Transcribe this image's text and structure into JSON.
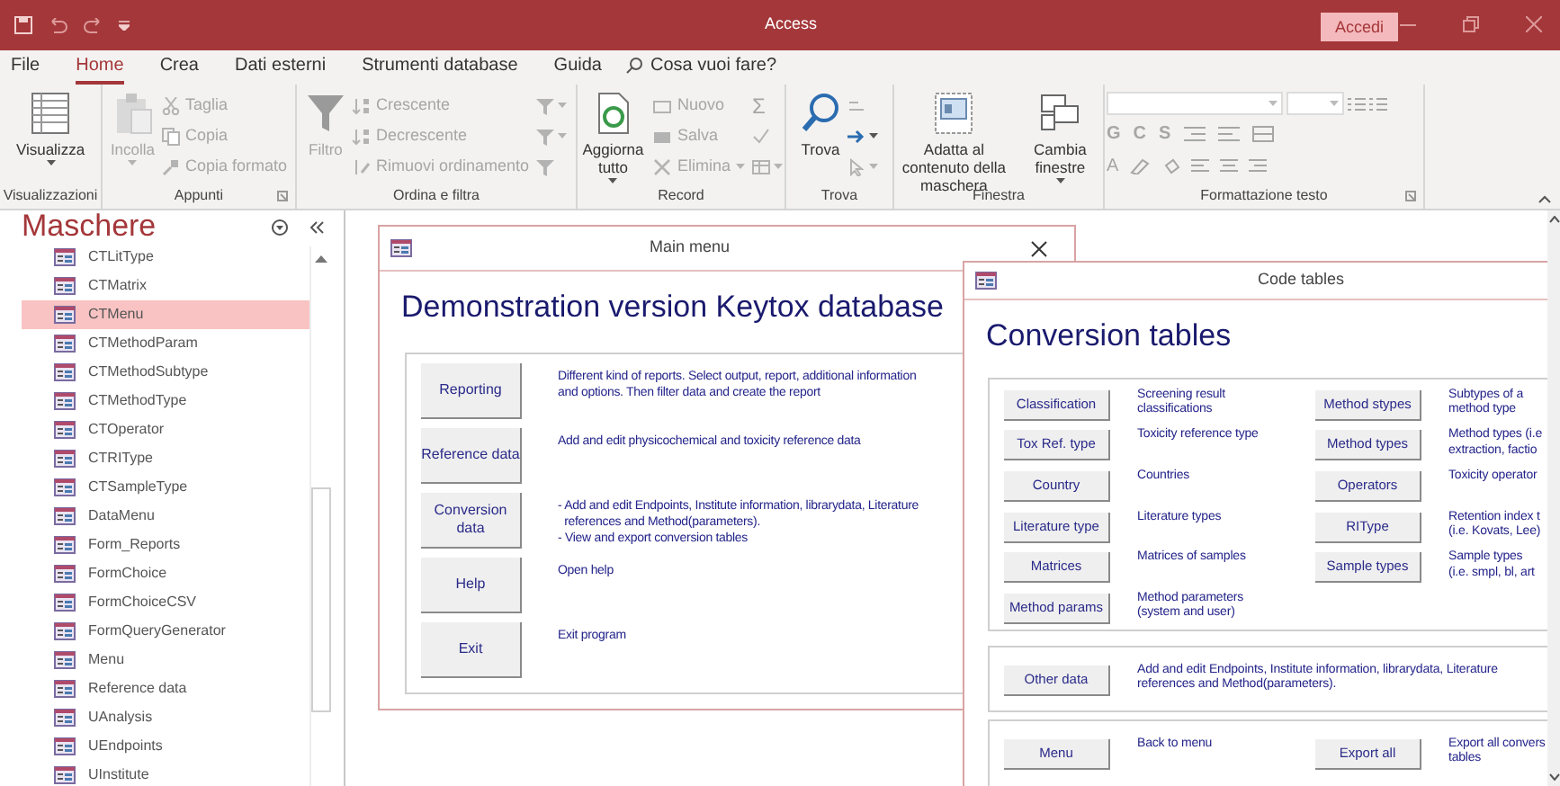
{
  "title_bar": {
    "title": "Access",
    "sign_in": "Accedi"
  },
  "ribbon_tabs": [
    {
      "label": "File",
      "selected": false
    },
    {
      "label": "Home",
      "selected": true
    },
    {
      "label": "Crea",
      "selected": false
    },
    {
      "label": "Dati esterni",
      "selected": false
    },
    {
      "label": "Strumenti database",
      "selected": false
    },
    {
      "label": "Guida",
      "selected": false
    }
  ],
  "tell_me": {
    "placeholder": "Cosa vuoi fare?"
  },
  "ribbon_groups": [
    {
      "label": "Visualizzazioni",
      "kind": "buttons",
      "columns": [
        [
          {
            "kind": "large",
            "label": "Visualizza",
            "dropdown": true,
            "disabled": false
          }
        ]
      ]
    },
    {
      "label": "Appunti",
      "kind": "buttons",
      "launcher": true,
      "columns": [
        [
          {
            "kind": "large",
            "label": "Incolla",
            "dropdown": true,
            "disabled": true
          }
        ],
        [
          {
            "kind": "small",
            "label": "Taglia",
            "disabled": true
          },
          {
            "kind": "small",
            "label": "Copia",
            "disabled": true
          },
          {
            "kind": "small",
            "label": "Copia formato",
            "disabled": true
          }
        ]
      ]
    },
    {
      "label": "Ordina e filtra",
      "kind": "buttons",
      "columns": [
        [
          {
            "kind": "large",
            "label": "Filtro",
            "disabled": true
          }
        ],
        [
          {
            "kind": "small",
            "label": "Crescente",
            "disabled": true
          },
          {
            "kind": "small",
            "label": "Decrescente",
            "disabled": true
          },
          {
            "kind": "small",
            "label": "Rimuovi ordinamento",
            "disabled": true
          }
        ],
        [
          {
            "kind": "icon",
            "dropdown": true,
            "disabled": true
          },
          {
            "kind": "icon",
            "dropdown": true,
            "disabled": true
          },
          {
            "kind": "icon",
            "disabled": true
          }
        ]
      ]
    },
    {
      "label": "Record",
      "kind": "buttons",
      "columns": [
        [
          {
            "kind": "large",
            "label": "Aggiorna tutto",
            "dropdown": true,
            "disabled": false
          }
        ],
        [
          {
            "kind": "small",
            "label": "Nuovo",
            "disabled": true
          },
          {
            "kind": "small",
            "label": "Salva",
            "disabled": true
          },
          {
            "kind": "small",
            "label": "Elimina",
            "dropdown": true,
            "disabled": true
          }
        ],
        [
          {
            "kind": "glyph",
            "label": "Σ",
            "disabled": true
          },
          {
            "kind": "icon",
            "disabled": true
          },
          {
            "kind": "icon",
            "dropdown": true,
            "disabled": true
          }
        ]
      ]
    },
    {
      "label": "Trova",
      "kind": "buttons",
      "columns": [
        [
          {
            "kind": "large",
            "label": "Trova",
            "disabled": false
          }
        ],
        [
          {
            "kind": "icon",
            "disabled": true
          },
          {
            "kind": "icon",
            "dropdown": true,
            "disabled": false
          },
          {
            "kind": "icon",
            "dropdown": true,
            "disabled": true
          }
        ]
      ]
    },
    {
      "label": "Finestra",
      "kind": "buttons",
      "columns": [
        [
          {
            "kind": "large",
            "label": "Adatta al contenuto della maschera",
            "disabled": false
          }
        ],
        [
          {
            "kind": "large",
            "label": "Cambia finestre",
            "dropdown": true,
            "disabled": false
          }
        ]
      ]
    },
    {
      "label": "Formattazione testo",
      "kind": "format",
      "launcher": true,
      "letters": [
        "G",
        "C",
        "S"
      ],
      "color_letter": "A"
    }
  ],
  "navigation": {
    "title": "Maschere",
    "items": [
      {
        "label": "CTLitType",
        "selected": false
      },
      {
        "label": "CTMatrix",
        "selected": false
      },
      {
        "label": "CTMenu",
        "selected": true
      },
      {
        "label": "CTMethodParam",
        "selected": false
      },
      {
        "label": "CTMethodSubtype",
        "selected": false
      },
      {
        "label": "CTMethodType",
        "selected": false
      },
      {
        "label": "CTOperator",
        "selected": false
      },
      {
        "label": "CTRIType",
        "selected": false
      },
      {
        "label": "CTSampleType",
        "selected": false
      },
      {
        "label": "DataMenu",
        "selected": false
      },
      {
        "label": "Form_Reports",
        "selected": false
      },
      {
        "label": "FormChoice",
        "selected": false
      },
      {
        "label": "FormChoiceCSV",
        "selected": false
      },
      {
        "label": "FormQueryGenerator",
        "selected": false
      },
      {
        "label": "Menu",
        "selected": false
      },
      {
        "label": "Reference data",
        "selected": false
      },
      {
        "label": "UAnalysis",
        "selected": false
      },
      {
        "label": "UEndpoints",
        "selected": false
      },
      {
        "label": "UInstitute",
        "selected": false
      }
    ]
  },
  "main_menu": {
    "title": "Main menu",
    "heading": "Demonstration version Keytox database",
    "rows": [
      {
        "button": "Reporting",
        "description": [
          "Different kind of reports. Select output, report, additional information",
          "and options. Then filter data and create the report"
        ]
      },
      {
        "button": "Reference data",
        "description": [
          "Add and edit physicochemical and toxicity reference data"
        ]
      },
      {
        "button": "Conversion data",
        "description": [
          "- Add and edit Endpoints, Institute information, librarydata, Literature",
          "  references and Method(parameters).",
          "- View and export conversion tables"
        ]
      },
      {
        "button": "Help",
        "description": [
          "Open help"
        ]
      },
      {
        "button": "Exit",
        "description": [
          "Exit program"
        ]
      }
    ]
  },
  "code_tables": {
    "title": "Code tables",
    "heading": "Conversion tables",
    "left_column": [
      {
        "button": "Classification",
        "description": [
          "Screening result",
          "classifications"
        ]
      },
      {
        "button": "Tox Ref. type",
        "description": [
          "Toxicity reference type"
        ]
      },
      {
        "button": "Country",
        "description": [
          "Countries"
        ]
      },
      {
        "button": "Literature type",
        "description": [
          "Literature types"
        ]
      },
      {
        "button": "Matrices",
        "description": [
          "Matrices of samples"
        ]
      },
      {
        "button": "Method params",
        "description": [
          "Method parameters",
          "(system and user)"
        ]
      }
    ],
    "right_column": [
      {
        "button": "Method stypes",
        "description": [
          "Subtypes of a",
          "method type"
        ]
      },
      {
        "button": "Method types",
        "description": [
          "Method types (i.e",
          "extraction, factio"
        ]
      },
      {
        "button": "Operators",
        "description": [
          "Toxicity operator"
        ]
      },
      {
        "button": "RIType",
        "description": [
          "Retention index t",
          "(i.e. Kovats, Lee)"
        ]
      },
      {
        "button": "Sample types",
        "description": [
          "Sample types",
          "(i.e. smpl, bl, art"
        ]
      }
    ],
    "other": {
      "button": "Other data",
      "description": [
        "Add and edit Endpoints, Institute information, librarydata, Literature",
        "references and Method(parameters)."
      ]
    },
    "footer": [
      {
        "button": "Menu",
        "description": [
          "Back to menu"
        ]
      },
      {
        "button": "Export all",
        "description": [
          "Export all convers",
          "tables"
        ]
      }
    ]
  }
}
